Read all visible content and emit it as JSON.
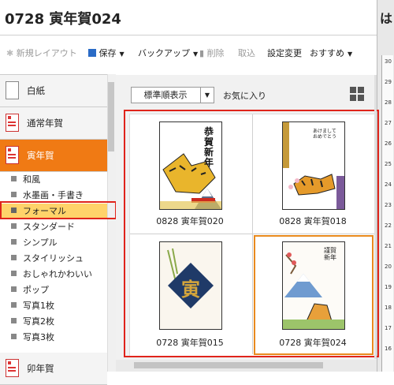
{
  "window": {
    "title": "0728 寅年賀024",
    "right_panel_head": "は"
  },
  "toolbar": {
    "new_layout": "新規レイアウト",
    "save": "保存",
    "backup": "バックアップ",
    "delete": "削除",
    "import": "取込",
    "settings": "設定変更",
    "recommend": "おすすめ"
  },
  "sidebar": {
    "blank": "白紙",
    "normal_nenga": "通常年賀",
    "tora_nenga": "寅年賀",
    "sub_items": [
      "和風",
      "水墨画・手書き",
      "フォーマル",
      "スタンダード",
      "シンプル",
      "スタイリッシュ",
      "おしゃれかわいい",
      "ポップ",
      "写真1枚",
      "写真2枚",
      "写真3枚"
    ],
    "selected_sub": "フォーマル",
    "u_nenga": "卯年賀"
  },
  "content": {
    "sort_label": "標準順表示",
    "favorites": "お気に入り",
    "cards": [
      {
        "label": "0828 寅年賀020",
        "art_text": "恭賀新年"
      },
      {
        "label": "0828 寅年賀018",
        "art_text": "あけましておめでとう"
      },
      {
        "label": "0728 寅年賀015",
        "art_text": "寅"
      },
      {
        "label": "0728 寅年賀024",
        "art_text": "謹賀新年"
      }
    ]
  },
  "ruler": {
    "ticks": [
      "30",
      "29",
      "28",
      "27",
      "26",
      "25",
      "24",
      "23",
      "22",
      "21",
      "20",
      "19",
      "18",
      "17",
      "16"
    ]
  },
  "colors": {
    "accent_orange": "#f07a14",
    "highlight_red": "#e0241b",
    "selected_yellow": "#ffd36a",
    "card_frame_orange": "#e98a1e"
  }
}
